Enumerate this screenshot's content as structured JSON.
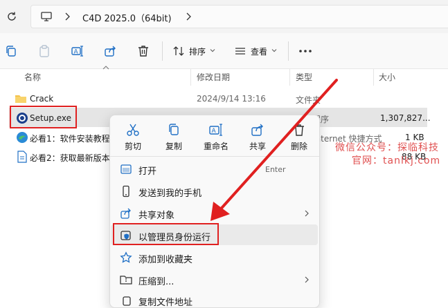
{
  "address_bar": {
    "path_label": "C4D 2025.0（64bit)"
  },
  "toolbar": {
    "sort_label": "排序",
    "view_label": "查看"
  },
  "columns": {
    "name": "名称",
    "modified": "修改日期",
    "type": "类型",
    "size": "大小"
  },
  "files": [
    {
      "name": "Crack",
      "modified": "2024/9/14 13:16",
      "type": "文件夹",
      "size": ""
    },
    {
      "name": "Setup.exe",
      "modified": "",
      "type": "应用程序",
      "size": "1,307,827..."
    },
    {
      "name": "必看1：软件安装教程",
      "modified": "",
      "type": "Internet 快捷方式",
      "size": "1 KB"
    },
    {
      "name": "必看2：获取最新版本",
      "modified": "",
      "type": "",
      "size": "88 KB"
    }
  ],
  "context_menu": {
    "quick_actions": [
      {
        "label": "剪切",
        "icon": "scissors-icon"
      },
      {
        "label": "复制",
        "icon": "copy-icon"
      },
      {
        "label": "重命名",
        "icon": "rename-icon"
      },
      {
        "label": "共享",
        "icon": "share-icon"
      },
      {
        "label": "删除",
        "icon": "trash-icon"
      }
    ],
    "items": [
      {
        "label": "打开",
        "shortcut": "Enter"
      },
      {
        "label": "发送到我的手机"
      },
      {
        "label": "共享对象"
      },
      {
        "label": "以管理员身份运行"
      },
      {
        "label": "添加到收藏夹"
      },
      {
        "label": "压缩到..."
      },
      {
        "label": "复制文件地址"
      }
    ]
  },
  "watermark": {
    "line1": "微信公众号：探临科技",
    "line2": "官网：tanlkj.com"
  },
  "colors": {
    "highlight_red": "#e02020",
    "accent_blue": "#1f6fc5"
  }
}
